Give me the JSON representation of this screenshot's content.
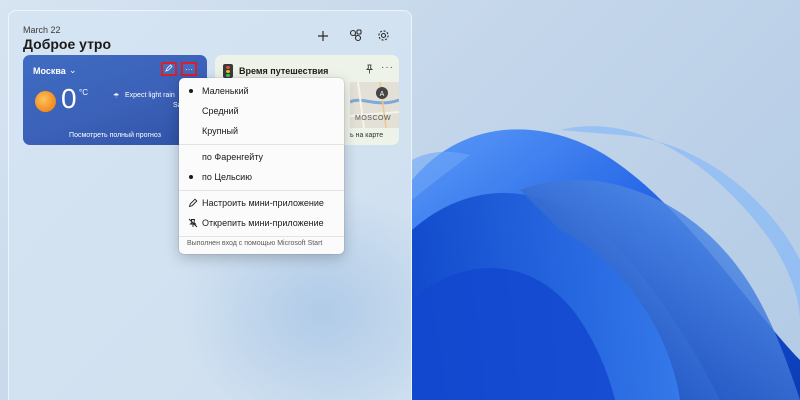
{
  "board": {
    "date": "March 22",
    "greeting": "Доброе утро",
    "add_icon": "plus-icon",
    "customize_icon": "widgets-link-icon",
    "settings_icon": "gear-icon"
  },
  "weather": {
    "city": "Москва",
    "temperature": "0",
    "unit": "°C",
    "condition": "Expect light rain",
    "condition_sub": "Saturd",
    "full_forecast_link": "Посмотреть полный прогноз"
  },
  "travel": {
    "title": "Время путешествия",
    "map_label": "MOSCOW",
    "map_pin_letter": "A",
    "link_partial": "ь на карте"
  },
  "menu": {
    "sizes": [
      {
        "label": "Маленький",
        "selected": true
      },
      {
        "label": "Средний",
        "selected": false
      },
      {
        "label": "Крупный",
        "selected": false
      }
    ],
    "units": [
      {
        "label": "по Фаренгейту",
        "selected": false
      },
      {
        "label": "по Цельсию",
        "selected": true
      }
    ],
    "actions": [
      {
        "label": "Настроить мини-приложение",
        "icon": "pencil-icon"
      },
      {
        "label": "Открепить мини-приложение",
        "icon": "unpin-icon"
      }
    ],
    "footer": "Выполнен вход с помощью Microsoft Start"
  },
  "colors": {
    "weather_card": "#3b61b8",
    "highlight_border": "#d81f2a",
    "wallpaper_accent": "#1f5fe0"
  }
}
